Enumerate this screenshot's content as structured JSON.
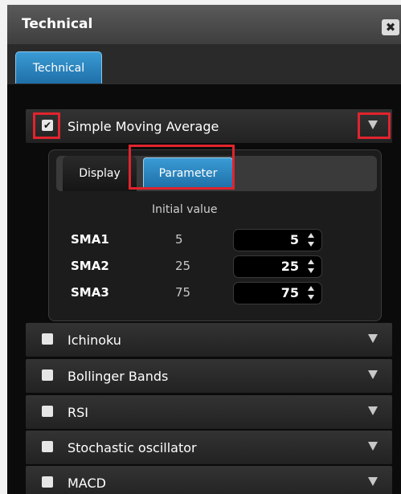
{
  "window": {
    "title": "Technical",
    "close_glyph": "✖",
    "close_icon": "close-icon"
  },
  "tabs": [
    {
      "label": "Technical",
      "active": true
    }
  ],
  "indicators": [
    {
      "label": "Simple Moving Average",
      "checked": true,
      "expanded": true
    },
    {
      "label": "Ichinoku",
      "checked": false
    },
    {
      "label": "Bollinger Bands",
      "checked": false
    },
    {
      "label": "RSI",
      "checked": false
    },
    {
      "label": "Stochastic oscillator",
      "checked": false
    },
    {
      "label": "MACD",
      "checked": false
    }
  ],
  "sma_panel": {
    "subtabs": [
      {
        "label": "Display",
        "active": false
      },
      {
        "label": "Parameter",
        "active": true
      }
    ],
    "initial_value_header": "Initial value",
    "params": [
      {
        "name": "SMA1",
        "initial": "5",
        "value": "5"
      },
      {
        "name": "SMA2",
        "initial": "25",
        "value": "25"
      },
      {
        "name": "SMA3",
        "initial": "75",
        "value": "75"
      }
    ]
  },
  "check_glyph": "✔",
  "colors": {
    "accent_blue": "#2a88c4",
    "highlight_red": "#e0242e",
    "panel_bg": "#0b0b0b"
  }
}
